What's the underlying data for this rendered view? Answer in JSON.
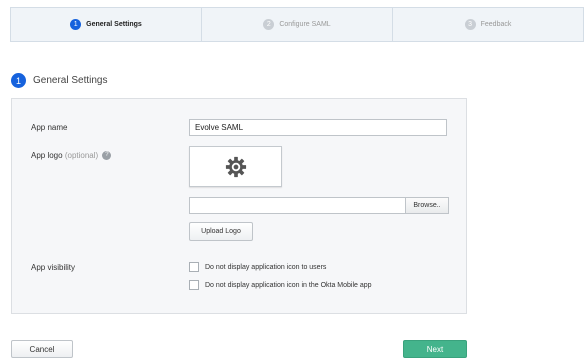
{
  "steps": [
    {
      "num": "1",
      "label": "General Settings"
    },
    {
      "num": "2",
      "label": "Configure SAML"
    },
    {
      "num": "3",
      "label": "Feedback"
    }
  ],
  "section": {
    "num": "1",
    "title": "General Settings"
  },
  "form": {
    "app_name_label": "App name",
    "app_name_value": "Evolve SAML",
    "app_logo_label": "App logo",
    "app_logo_optional": "(optional)",
    "help_glyph": "?",
    "browse_label": "Browse..",
    "upload_label": "Upload Logo",
    "visibility_label": "App visibility",
    "visibility_options": [
      "Do not display application icon to users",
      "Do not display application icon in the Okta Mobile app"
    ]
  },
  "footer": {
    "cancel_label": "Cancel",
    "next_label": "Next"
  },
  "colors": {
    "accent": "#1662dd",
    "next": "#44b48c"
  },
  "icons": {
    "logo_placeholder": "gear-icon",
    "help": "help-icon"
  }
}
